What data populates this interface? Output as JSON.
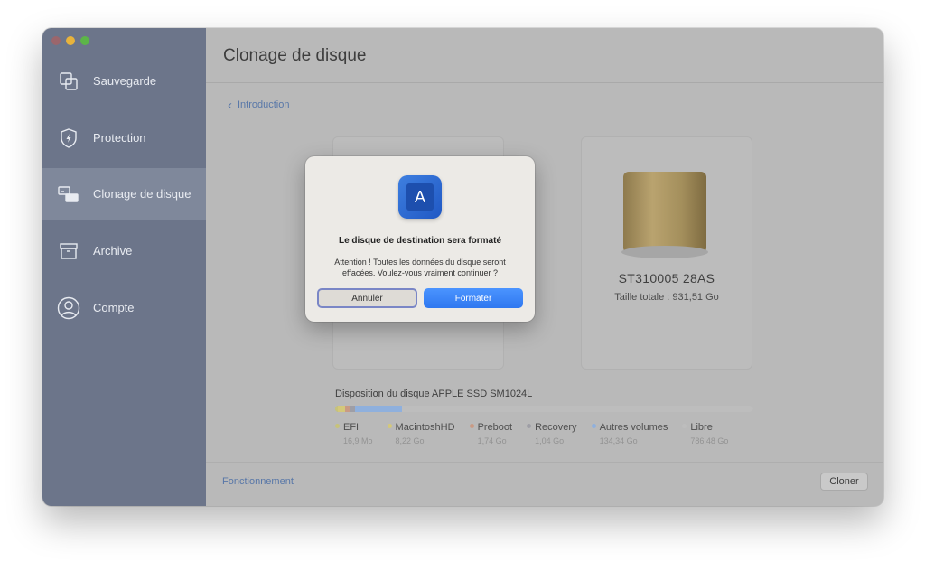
{
  "sidebar": {
    "items": [
      {
        "label": "Sauvegarde",
        "icon": "copy-icon"
      },
      {
        "label": "Protection",
        "icon": "shield-bolt-icon"
      },
      {
        "label": "Clonage de disque",
        "icon": "disk-clone-icon",
        "active": true
      },
      {
        "label": "Archive",
        "icon": "archive-box-icon"
      },
      {
        "label": "Compte",
        "icon": "user-icon"
      }
    ]
  },
  "main": {
    "title": "Clonage de disque",
    "breadcrumb": "Introduction",
    "target_disk": {
      "name": "ST310005 28AS",
      "size": "Taille totale : 931,51 Go"
    },
    "layout": {
      "title": "Disposition du disque APPLE SSD SM1024L",
      "segments": [
        {
          "name": "EFI",
          "size": "16,9 Mo",
          "color": "#c7c37a"
        },
        {
          "name": "MacintoshHD",
          "size": "8,22 Go",
          "color": "#d4c87a"
        },
        {
          "name": "Preboot",
          "size": "1,74 Go",
          "color": "#c99a84"
        },
        {
          "name": "Recovery",
          "size": "1,04 Go",
          "color": "#9e9ea6"
        },
        {
          "name": "Autres volumes",
          "size": "134,34 Go",
          "color": "#8fb0dd"
        },
        {
          "name": "Libre",
          "size": "786,48 Go",
          "color": "#bdbdbd"
        }
      ]
    },
    "footer_link": "Fonctionnement",
    "clone_button": "Cloner"
  },
  "dialog": {
    "title": "Le disque de destination sera formaté",
    "message": "Attention ! Toutes les données du disque seront effacées. Voulez-vous vraiment continuer ?",
    "cancel": "Annuler",
    "confirm": "Formater",
    "app_icon_letter": "A"
  },
  "colors": {
    "accent": "#2f78f0",
    "sidebar": "#6c758a",
    "link": "#5877a8"
  }
}
